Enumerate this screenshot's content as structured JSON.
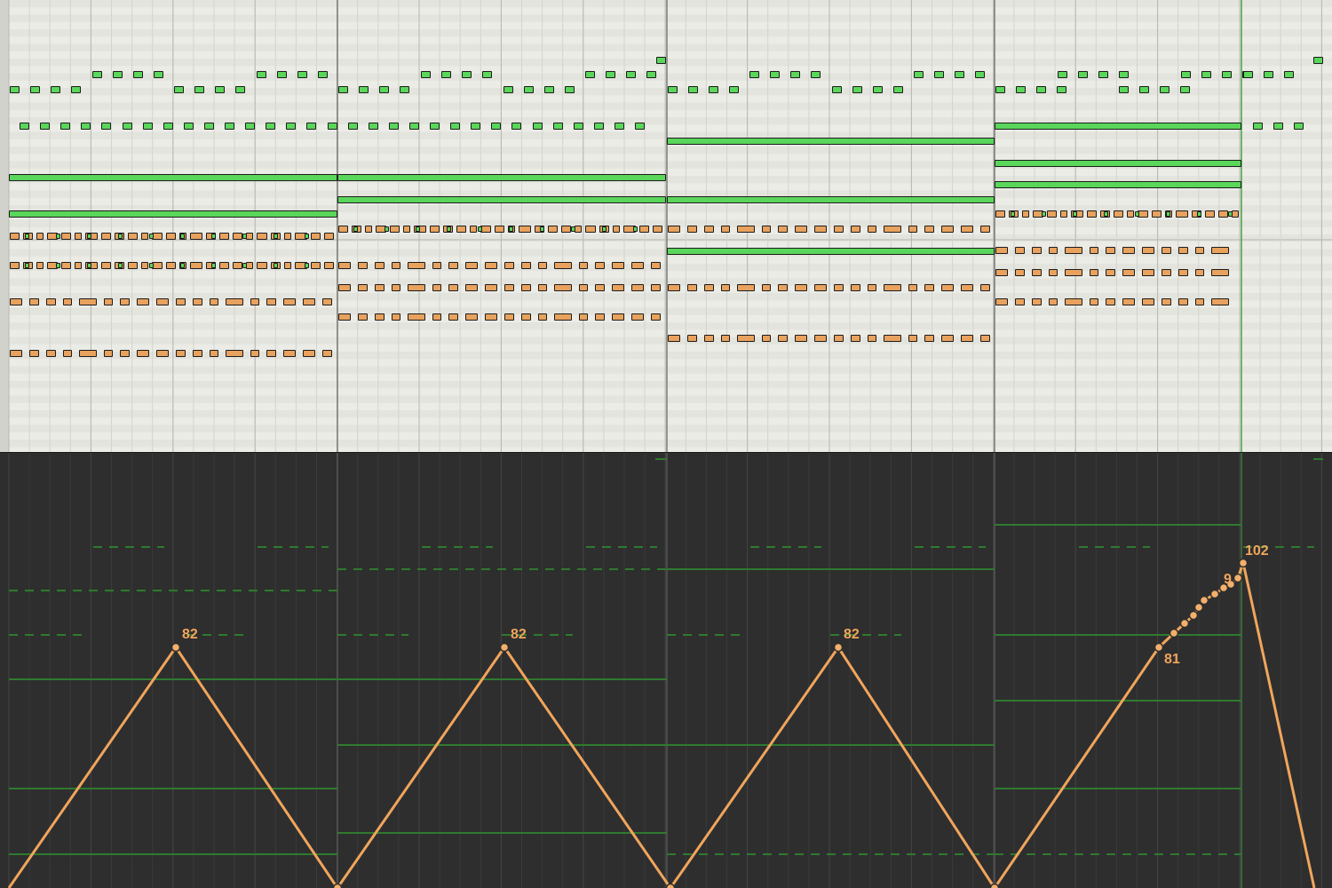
{
  "app": {
    "view": "MIDI editor",
    "lanes": [
      "piano-roll",
      "velocity-automation"
    ]
  },
  "colors": {
    "roll_background": "#ecece7",
    "automation_background": "#2e2e2e",
    "note_green": "#5ad65a",
    "note_orange": "#e8a25e",
    "note_border": "#1c1c1c",
    "automation_line": "#f0a55c",
    "velocity_green": "#2f7a2f"
  },
  "automation": {
    "labels": [
      "82",
      "82",
      "82",
      "81",
      "9",
      "102"
    ],
    "peak_value": "82",
    "last_peak_value": "102"
  },
  "sections": 4
}
